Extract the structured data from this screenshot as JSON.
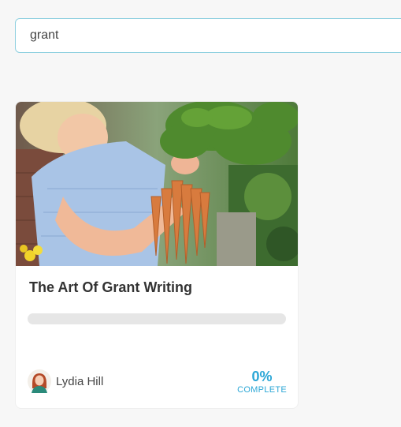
{
  "search": {
    "value": "grant"
  },
  "course": {
    "title": "The Art Of Grant Writing",
    "progress": 0,
    "percent_label": "0%",
    "complete_label": "COMPLETE",
    "author_name": "Lydia Hill"
  },
  "colors": {
    "accent": "#2ca7d6",
    "search_border": "#8fd0e0",
    "progress_track": "#e6e6e6",
    "title_text": "#333333",
    "background": "#f7f7f7"
  }
}
